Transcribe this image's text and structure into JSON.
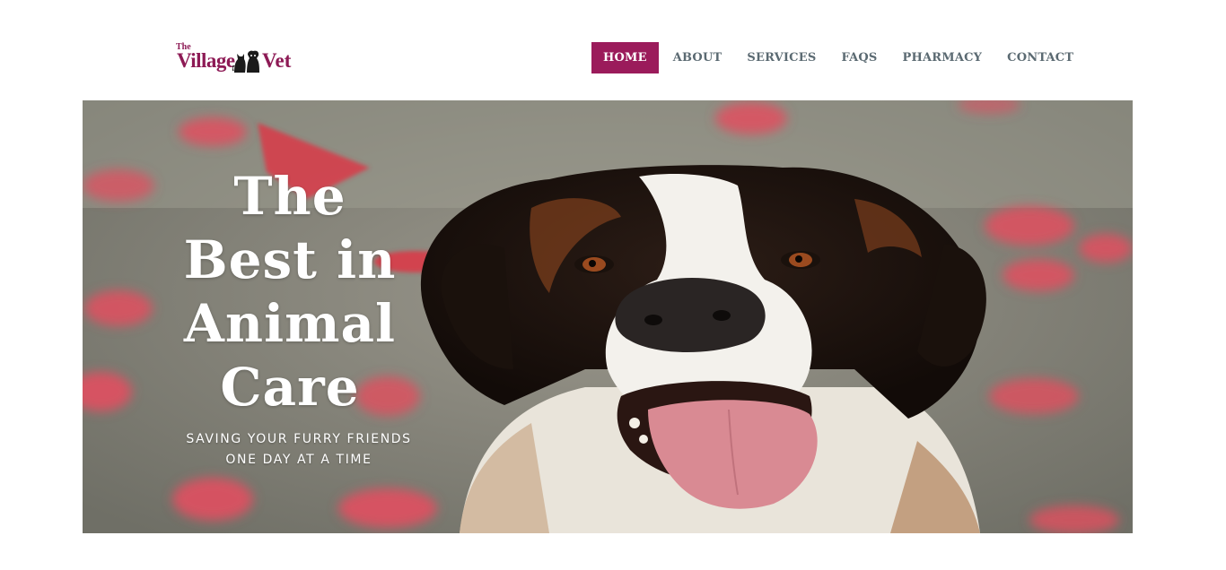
{
  "brand": {
    "the": "The",
    "village": "Village",
    "vet": "Vet",
    "color": "#8d1a55"
  },
  "nav": {
    "items": [
      {
        "label": "HOME",
        "active": true
      },
      {
        "label": "ABOUT"
      },
      {
        "label": "SERVICES"
      },
      {
        "label": "FAQS"
      },
      {
        "label": "PHARMACY"
      },
      {
        "label": "CONTACT"
      }
    ],
    "active_color": "#9b1b5b",
    "text_color": "#5b6a72"
  },
  "hero": {
    "headline_lines": [
      "The",
      "Best in",
      "Animal",
      "Care"
    ],
    "subtitle_lines": [
      "SAVING YOUR FURRY FRIENDS",
      "ONE DAY AT A TIME"
    ],
    "image_subject": "dog-photo"
  }
}
